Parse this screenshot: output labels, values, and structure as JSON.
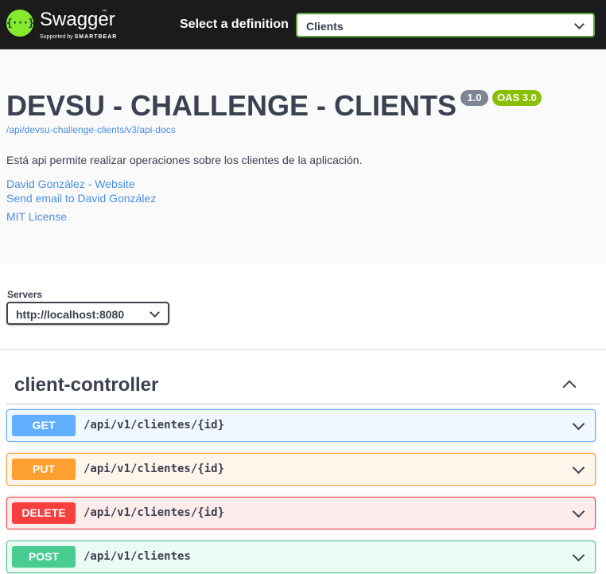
{
  "topbar": {
    "logo_glyph": "{···}",
    "brand_name": "Swagger",
    "brand_tm": "™",
    "brand_sub_prefix": "Supported by",
    "brand_sub_company": "SMARTBEAR",
    "select_label": "Select a definition",
    "definition_value": "Clients"
  },
  "info": {
    "title": "DEVSU - CHALLENGE - CLIENTS",
    "version_badge": "1.0",
    "oas_badge": "OAS 3.0",
    "api_url": "/api/devsu-challenge-clients/v3/api-docs",
    "description": "Está api permite realizar operaciones sobre los clientes de la aplicación.",
    "contact_website": "David González - Website",
    "contact_email": "Send email to David González",
    "license": "MIT License"
  },
  "servers": {
    "label": "Servers",
    "selected": "http://localhost:8080"
  },
  "tag": {
    "name": "client-controller"
  },
  "operations": [
    {
      "method": "GET",
      "path": "/api/v1/clientes/{id}"
    },
    {
      "method": "PUT",
      "path": "/api/v1/clientes/{id}"
    },
    {
      "method": "DELETE",
      "path": "/api/v1/clientes/{id}"
    },
    {
      "method": "POST",
      "path": "/api/v1/clientes"
    }
  ],
  "colors": {
    "topbar_bg": "#1b1b1b",
    "brand_green": "#85ea2d",
    "get": "#61affe",
    "put": "#fca130",
    "delete": "#f93e3e",
    "post": "#49cc90",
    "link": "#4990e2"
  },
  "icons": {
    "logo": "swagger-logo-icon",
    "dropdown": "chevron-down-icon",
    "collapse": "chevron-up-icon"
  }
}
